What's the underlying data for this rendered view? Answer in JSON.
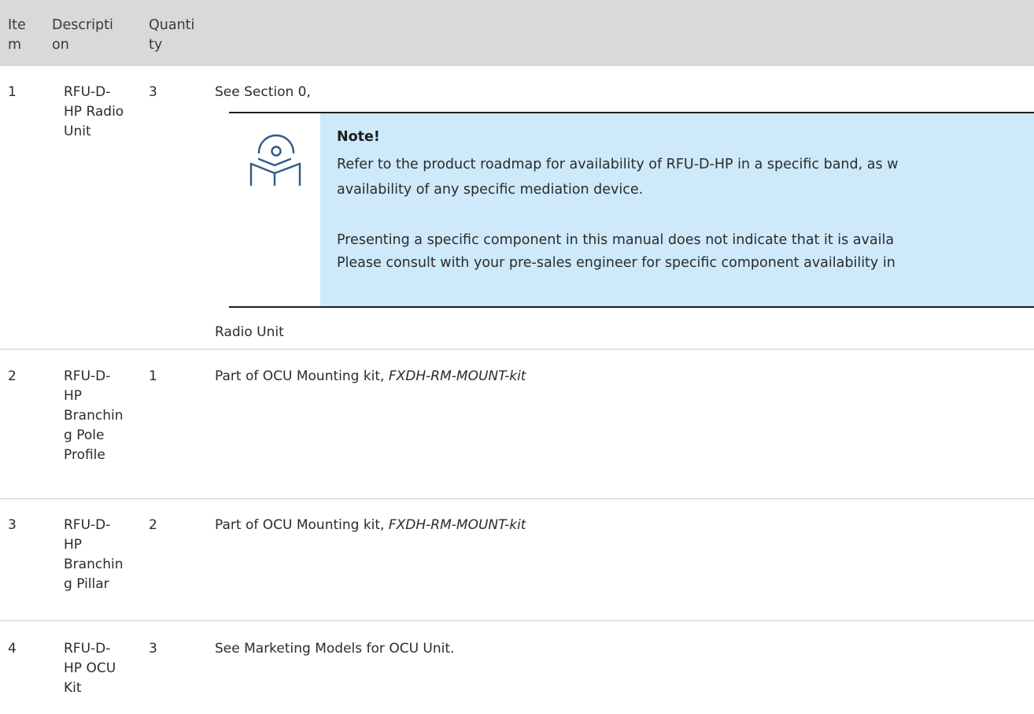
{
  "table": {
    "headers": [
      "Ite\nm",
      "Descripti\non",
      "Quanti\nty",
      ""
    ],
    "rows": [
      {
        "item": "1",
        "description": "RFU-D-\nHP Radio\nUnit",
        "quantity": "3",
        "notes_pre": "See Section 0,",
        "notes_post": "Radio Unit"
      },
      {
        "item": "2",
        "description": "RFU-D-\nHP\nBranchin\ng Pole\nProfile",
        "quantity": "1",
        "notes_text": "Part of OCU Mounting kit, ",
        "notes_italic": "FXDH-RM-MOUNT-kit"
      },
      {
        "item": "3",
        "description": "RFU-D-\nHP\nBranchin\ng Pillar",
        "quantity": "2",
        "notes_text": "Part of OCU Mounting kit, ",
        "notes_italic": "FXDH-RM-MOUNT-kit"
      },
      {
        "item": "4",
        "description": "RFU-D-\nHP OCU\nKit",
        "quantity": "3",
        "notes_text": "See Marketing Models for OCU Unit."
      }
    ]
  },
  "note": {
    "icon": "reading-book-icon",
    "title": "Note!",
    "lines": [
      "Refer to the product roadmap for availability of RFU-D-HP in a specific band, as w",
      "availability of any specific mediation device.",
      "Presenting a specific component in this manual does not indicate that it is availa",
      "Please consult with your pre-sales engineer for specific component availability in"
    ]
  },
  "colors": {
    "header_bg": "#d9d9d9",
    "note_bg": "#cde9fa",
    "icon_stroke": "#2f5b8a",
    "rule": "#cfcfcf"
  }
}
